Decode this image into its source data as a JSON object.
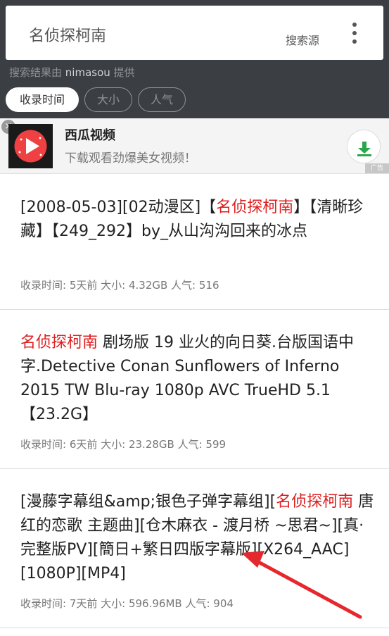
{
  "search": {
    "query": "名侦探柯南",
    "source_button": "搜索源",
    "powered_prefix": "搜索结果由 ",
    "powered_source": "nimasou",
    "powered_suffix": " 提供"
  },
  "sort_tabs": [
    {
      "label": "收录时间",
      "active": true
    },
    {
      "label": "大小",
      "active": false
    },
    {
      "label": "人气",
      "active": false
    }
  ],
  "ad": {
    "close": "×",
    "title": "西瓜视频",
    "subtitle": "下载观看劲爆美女视频！",
    "tag": "广告"
  },
  "meta_labels": {
    "time": "收录时间: ",
    "size": " 大小: ",
    "popularity": " 人气: "
  },
  "results": [
    {
      "title_before": "[2008-05-03][02动漫区]【",
      "title_highlight": "名侦探柯南",
      "title_after": "】【清晰珍藏】【249_292】by_从山沟沟回来的冰点",
      "time": "5天前",
      "size": "4.32GB",
      "popularity": "516"
    },
    {
      "title_before": "",
      "title_highlight": "名侦探柯南",
      "title_after": " 剧场版 19 业火的向日葵.台版国语中字.Detective Conan Sunflowers of Inferno 2015 TW Blu-ray 1080p AVC TrueHD 5.1【23.2G】",
      "time": "6天前",
      "size": "23.28GB",
      "popularity": "599"
    },
    {
      "title_before": "[漫藤字幕组&amp;银色子弹字幕组][",
      "title_highlight": "名侦探柯南",
      "title_after": " 唐红的恋歌 主题曲][仓木麻衣 - 渡月桥 ~思君~][真·完整版PV][簡日+繁日四版字幕版][X264_AAC][1080P][MP4]",
      "time": "7天前",
      "size": "596.96MB",
      "popularity": "904"
    }
  ],
  "colors": {
    "header_bg": "#3b3f44",
    "highlight": "#e01e1e",
    "arrow": "#e5282d",
    "logo_red": "#f04142",
    "download_green": "#29a64a"
  }
}
